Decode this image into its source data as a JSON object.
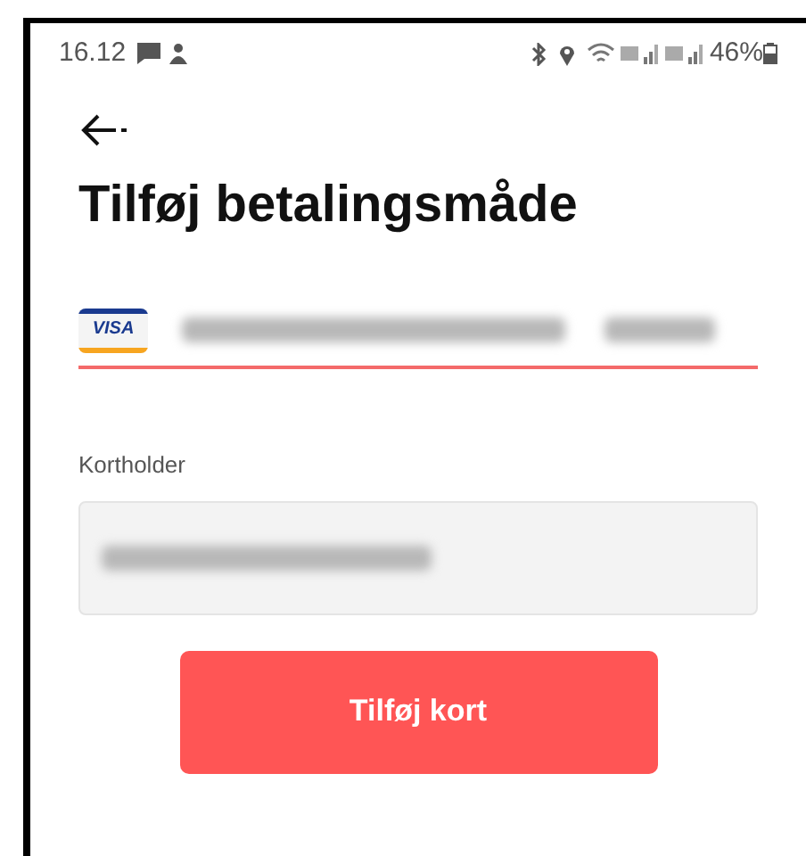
{
  "status_bar": {
    "time": "16.12",
    "battery": "46%"
  },
  "title": "Tilføj betalingsmåde",
  "card_field": {
    "brand": "VISA"
  },
  "cardholder": {
    "label": "Kortholder"
  },
  "submit_button": "Tilføj kort"
}
